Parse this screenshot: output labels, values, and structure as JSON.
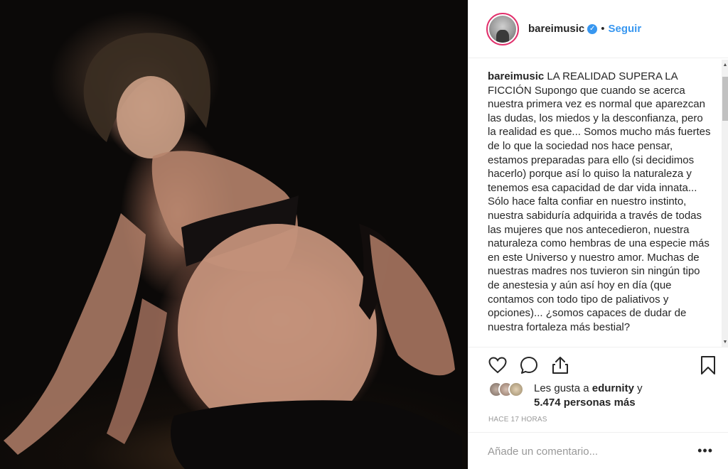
{
  "post": {
    "image_alt": "",
    "username": "bareimusic",
    "follow_label": "Seguir",
    "separator": "•",
    "caption_user": "bareimusic",
    "caption_text": "LA REALIDAD SUPERA LA FICCIÓN Supongo que cuando se acerca nuestra primera vez es normal que aparezcan las dudas, los miedos y la desconfianza, pero la realidad es que... Somos mucho más fuertes de lo que la sociedad nos hace pensar, estamos preparadas para ello (si decidimos hacerlo) porque así lo quiso la naturaleza y tenemos esa capacidad de dar vida innata... Sólo hace falta confiar en nuestro instinto, nuestra sabiduría adquirida a través de todas las mujeres que nos antecedieron, nuestra naturaleza como hembras de una especie más en este Universo y nuestro amor. Muchas de nuestras madres nos tuvieron sin ningún tipo de anestesia y aún así hoy en día (que contamos con todo tipo de paliativos y opciones)... ¿somos capaces de dudar de nuestra fortaleza más bestial?",
    "likes_prefix": "Les gusta a",
    "likes_user": "edurnity",
    "likes_conj": "y",
    "likes_count": "5.474 personas más",
    "timestamp": "HACE 17 HORAS",
    "comment_placeholder": "Añade un comentario...",
    "more_label": "•••"
  },
  "icons": {
    "verified": "verified-badge-icon",
    "like": "heart-icon",
    "comment": "comment-bubble-icon",
    "share": "share-icon",
    "save": "bookmark-icon"
  },
  "colors": {
    "accent": "#3897f0",
    "text": "#262626",
    "muted": "#999999",
    "border": "#efefef"
  }
}
